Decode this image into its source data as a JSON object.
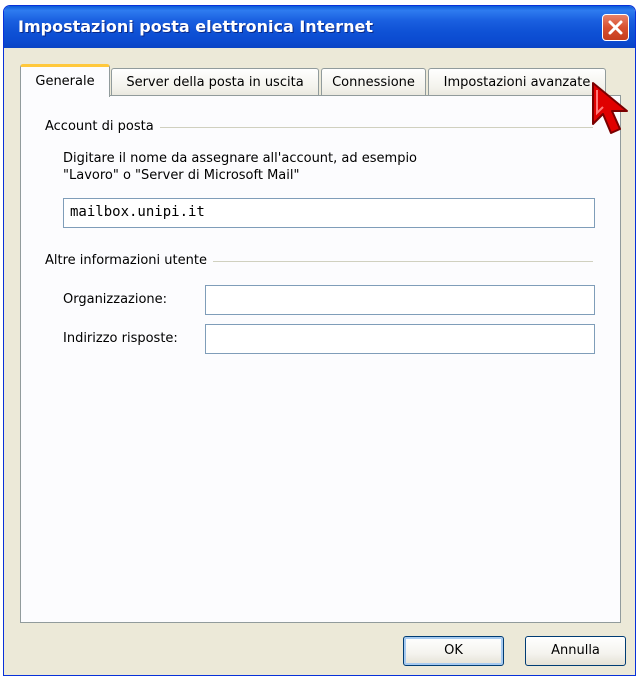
{
  "window": {
    "title": "Impostazioni posta elettronica Internet"
  },
  "tabs": [
    {
      "label": "Generale",
      "active": true
    },
    {
      "label": "Server della posta in uscita",
      "active": false
    },
    {
      "label": "Connessione",
      "active": false
    },
    {
      "label": "Impostazioni avanzate",
      "active": false
    }
  ],
  "account_group": {
    "label": "Account di posta",
    "description_line1": "Digitare il nome da assegnare all'account, ad esempio",
    "description_line2": "\"Lavoro\" o \"Server di Microsoft Mail\"",
    "account_name_value": "mailbox.unipi.it"
  },
  "user_info_group": {
    "label": "Altre informazioni utente",
    "organization_label": "Organizzazione:",
    "organization_value": "",
    "reply_address_label": "Indirizzo risposte:",
    "reply_address_value": ""
  },
  "buttons": {
    "ok_label": "OK",
    "cancel_label": "Annulla"
  },
  "colors": {
    "titlebar": "#0a5bd8",
    "close_button": "#d8502f",
    "active_tab_highlight": "#ffc83c",
    "pointer": "#e00000"
  },
  "icons": {
    "close": "close-icon",
    "pointer": "mouse-pointer-icon"
  }
}
